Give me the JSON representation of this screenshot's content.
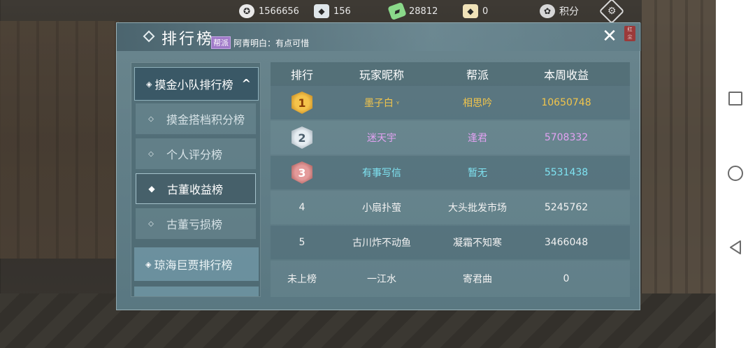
{
  "topbar": {
    "currencies": [
      {
        "icon": "film-reel-icon",
        "value": "1566656"
      },
      {
        "icon": "silver-ingot-icon",
        "value": "156"
      },
      {
        "icon": "jade-ticket-icon",
        "value": "28812"
      },
      {
        "icon": "gold-ingot-icon",
        "value": "0"
      }
    ],
    "points_label": "积分",
    "points_icon": "points-icon",
    "settings_icon": "settings-icon"
  },
  "panel": {
    "title": "排行榜",
    "chat": {
      "tag": "帮派",
      "message": "阿青明白：有点可惜"
    },
    "close_icon": "close-icon",
    "seal_text": "红尘"
  },
  "sidebar": {
    "category_open": {
      "label": "摸金小队排行榜",
      "chevron": "^"
    },
    "items": [
      {
        "label": "摸金搭档积分榜",
        "active": false
      },
      {
        "label": "个人评分榜",
        "active": false
      },
      {
        "label": "古董收益榜",
        "active": true
      },
      {
        "label": "古董亏损榜",
        "active": false
      }
    ],
    "category_closed": {
      "label": "琼海巨贾排行榜"
    }
  },
  "table": {
    "headers": {
      "rank": "排行",
      "name": "玩家昵称",
      "guild": "帮派",
      "income": "本周收益"
    },
    "rows": [
      {
        "rank": "1",
        "rank_badge": "gold",
        "name": "墨子白",
        "name_mark": "ᵞ",
        "guild": "相思吟",
        "income": "10650748",
        "color": "#f2c54b"
      },
      {
        "rank": "2",
        "rank_badge": "silver",
        "name": "迷天宇",
        "name_mark": "",
        "guild": "逢君",
        "income": "5708332",
        "color": "#e2a2f2"
      },
      {
        "rank": "3",
        "rank_badge": "bronze",
        "name": "有事写信",
        "name_mark": "",
        "guild": "暂无",
        "income": "5531438",
        "color": "#7fe3f2"
      },
      {
        "rank": "4",
        "rank_badge": "",
        "name": "小扇扑萤",
        "name_mark": "",
        "guild": "大头批发市场",
        "income": "5245762",
        "color": "#f2f2f2"
      },
      {
        "rank": "5",
        "rank_badge": "",
        "name": "古川炸不动鱼",
        "name_mark": "",
        "guild": "凝霜不知寒",
        "income": "3466048",
        "color": "#f2f2f2"
      }
    ],
    "self_row": {
      "rank": "未上榜",
      "name": "一江水",
      "guild": "寄君曲",
      "income": "0"
    }
  },
  "system_nav": {
    "recents_icon": "square-icon",
    "home_icon": "circle-icon",
    "back_icon": "back-triangle-icon"
  }
}
